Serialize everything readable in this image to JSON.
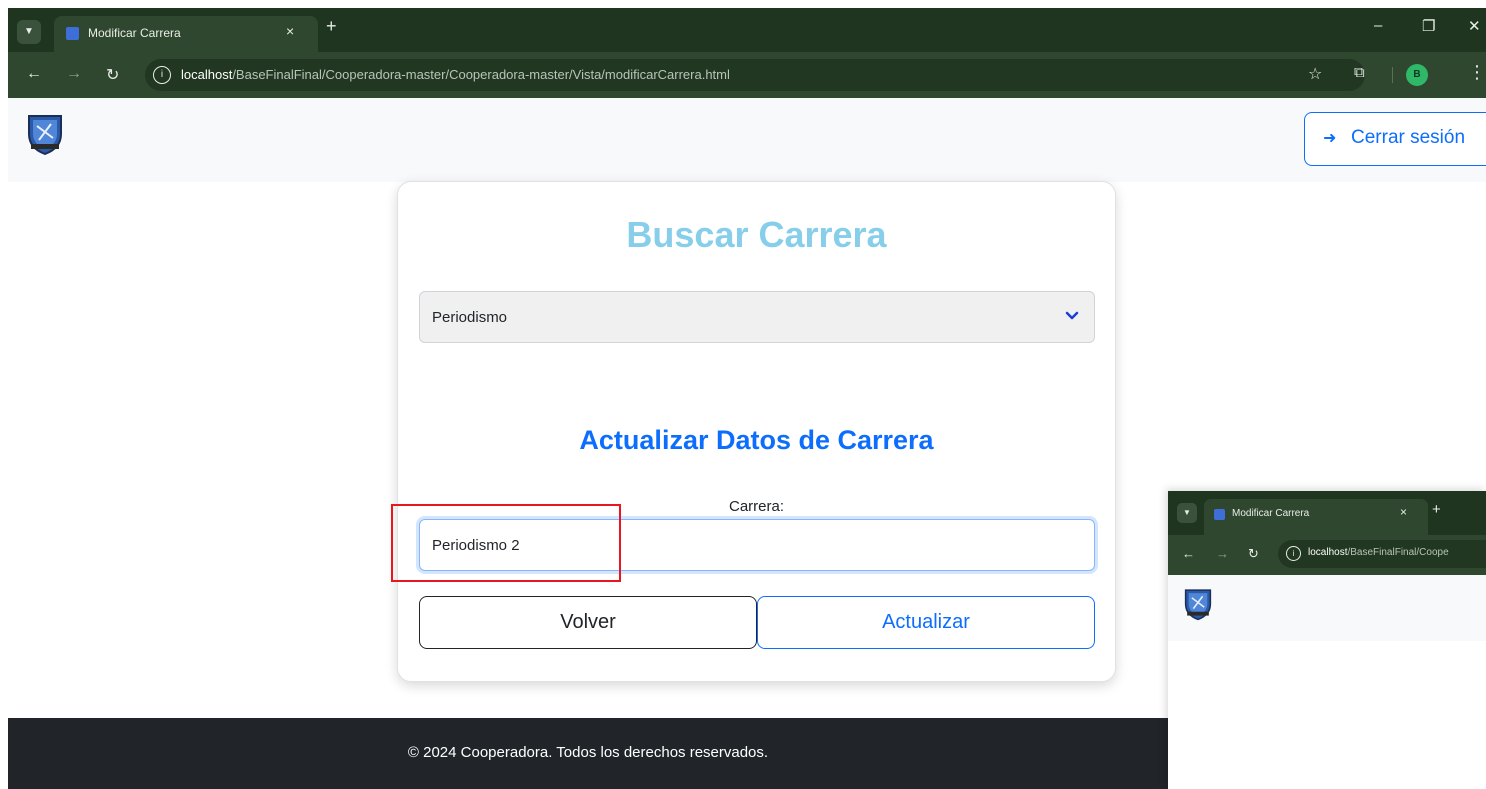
{
  "browser": {
    "tab_title": "Modificar Carrera",
    "tab_close": "×",
    "new_tab": "+",
    "url_host": "localhost",
    "url_path": "/BaseFinalFinal/Cooperadora-master/Cooperadora-master/Vista/modificarCarrera.html",
    "profile_initial": "B",
    "theme_color": "#1f3520"
  },
  "navbar": {
    "logout_label": "Cerrar sesión"
  },
  "card": {
    "search_title": "Buscar Carrera",
    "select_value": "Periodismo",
    "update_title": "Actualizar Datos de Carrera",
    "carrera_label": "Carrera:",
    "carrera_input_value": "Periodismo 2",
    "back_button": "Volver",
    "update_button": "Actualizar"
  },
  "footer": {
    "text": "© 2024 Cooperadora. Todos los derechos reservados."
  },
  "overlay_window": {
    "tab_title": "Modificar Carrera",
    "url_host": "localhost",
    "url_path": "/BaseFinalFinal/Coope"
  },
  "colors": {
    "search_title": "#87ceeb",
    "primary": "#0d6efd",
    "highlight_box": "#e8161e",
    "footer_bg": "#212529"
  }
}
